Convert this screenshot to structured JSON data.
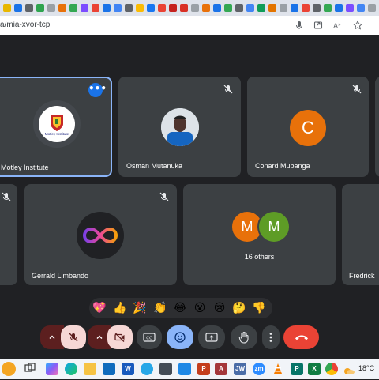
{
  "browser": {
    "url": "a/mia-xvor-tcp",
    "tab_favicon_colors": [
      "#e8b700",
      "#1a73e8",
      "#5f6368",
      "#2ea44f",
      "#9aa0a6",
      "#e8710a",
      "#34a853",
      "#7c4dff",
      "#ea4335",
      "#1a73e8",
      "#4285f4",
      "#5f6368",
      "#fbbc04",
      "#1877f2",
      "#ea4335",
      "#c5221f",
      "#d93025",
      "#9aa0a6",
      "#e8710a",
      "#1a73e8",
      "#34a853",
      "#5f6368",
      "#4285f4",
      "#0f9d58",
      "#e37400",
      "#9aa0a6",
      "#1a73e8",
      "#ea4335",
      "#5f6368",
      "#34a853",
      "#1a73e8",
      "#7c4dff",
      "#4285f4",
      "#9aa0a6",
      "#fbbc04",
      "#5f6368",
      "#1a73e8",
      "#34a853",
      "#e8710a",
      "#4285f4",
      "#5f6368"
    ],
    "close_glyph": "✕",
    "new_tab_glyph": "+",
    "icons": [
      "microphone-icon",
      "install-icon",
      "reader-mode-icon",
      "bookmark-star-icon"
    ]
  },
  "meet": {
    "tiles": [
      {
        "name": "Motley Institute",
        "logo_text": "Motley Institute",
        "active": true,
        "has_menu": true
      },
      {
        "name": "Osman Mutanuka",
        "muted": true
      },
      {
        "name": "Conard Mubanga",
        "initial": "C",
        "color": "#e8710a",
        "muted": true
      },
      {
        "name": "Gerrald Limbando",
        "muted": true
      },
      {
        "name": "16 others",
        "initials": [
          "M",
          "M"
        ],
        "colors": [
          "#e8710a",
          "#5e9c26"
        ]
      },
      {
        "name": "Fredrick"
      }
    ],
    "reactions": [
      "💖",
      "👍",
      "🎉",
      "👏",
      "😂",
      "😮",
      "😢",
      "🤔",
      "👎"
    ],
    "controls": {
      "mic": "off",
      "camera": "off",
      "captions": "CC",
      "emoji": "on",
      "present": "present",
      "raise_hand": "raise-hand",
      "more": "more",
      "leave": "end-call"
    },
    "colors": {
      "accent_blue": "#8ab4f8",
      "danger_red": "#ea4335",
      "off_bg": "#f6d7d5",
      "dark_red": "#5c1f1f"
    }
  },
  "taskbar": {
    "weather_temp": "18°C",
    "apps": [
      {
        "name": "task-view",
        "label": ""
      },
      {
        "name": "copilot",
        "label": ""
      },
      {
        "name": "edge",
        "label": ""
      },
      {
        "name": "file-explorer",
        "label": ""
      },
      {
        "name": "outlook",
        "label": ""
      },
      {
        "name": "word",
        "label": "W"
      },
      {
        "name": "telegram",
        "label": ""
      },
      {
        "name": "calculator",
        "label": ""
      },
      {
        "name": "vscode",
        "label": ""
      },
      {
        "name": "powerpoint",
        "label": "P"
      },
      {
        "name": "access",
        "label": "A"
      },
      {
        "name": "jw",
        "label": "JW"
      },
      {
        "name": "zoom",
        "label": "zm"
      },
      {
        "name": "vlc",
        "label": ""
      },
      {
        "name": "publisher",
        "label": "P"
      },
      {
        "name": "excel",
        "label": "X"
      },
      {
        "name": "chrome",
        "label": ""
      }
    ]
  }
}
